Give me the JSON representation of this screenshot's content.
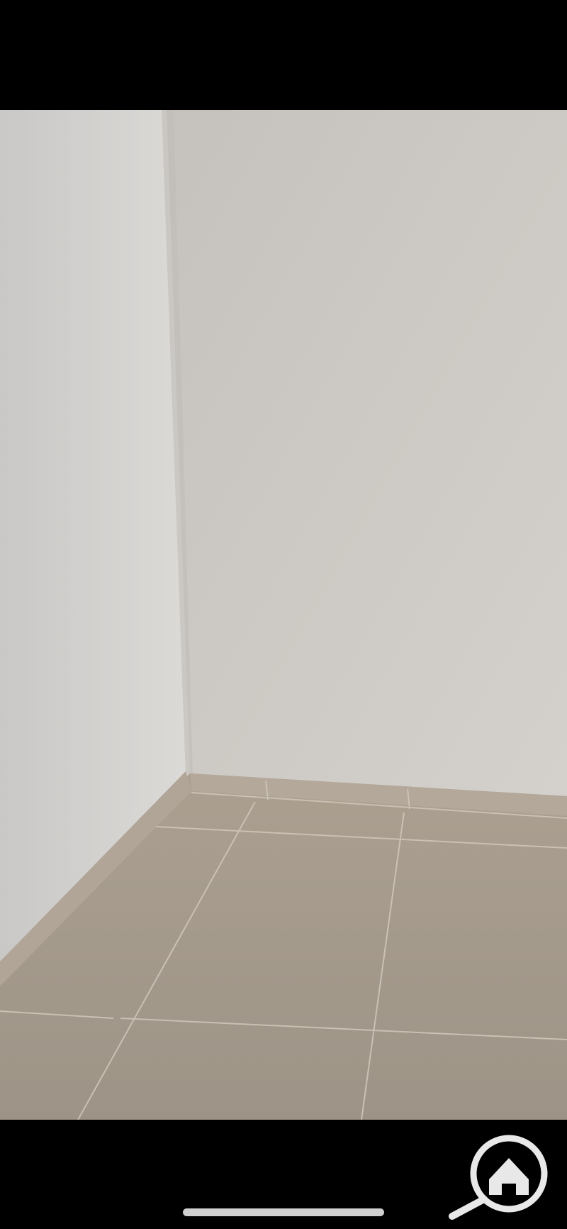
{
  "viewer": {
    "image_subject": "empty-room-photo",
    "watermark_icon": "home-search-icon",
    "colors": {
      "background": "#000000",
      "wall_left": "#d3d1ce",
      "wall_back": "#cbc7c2",
      "floor": "#a39a8d",
      "grout": "#cbc3b6",
      "home_indicator": "#cfcfcf"
    }
  }
}
